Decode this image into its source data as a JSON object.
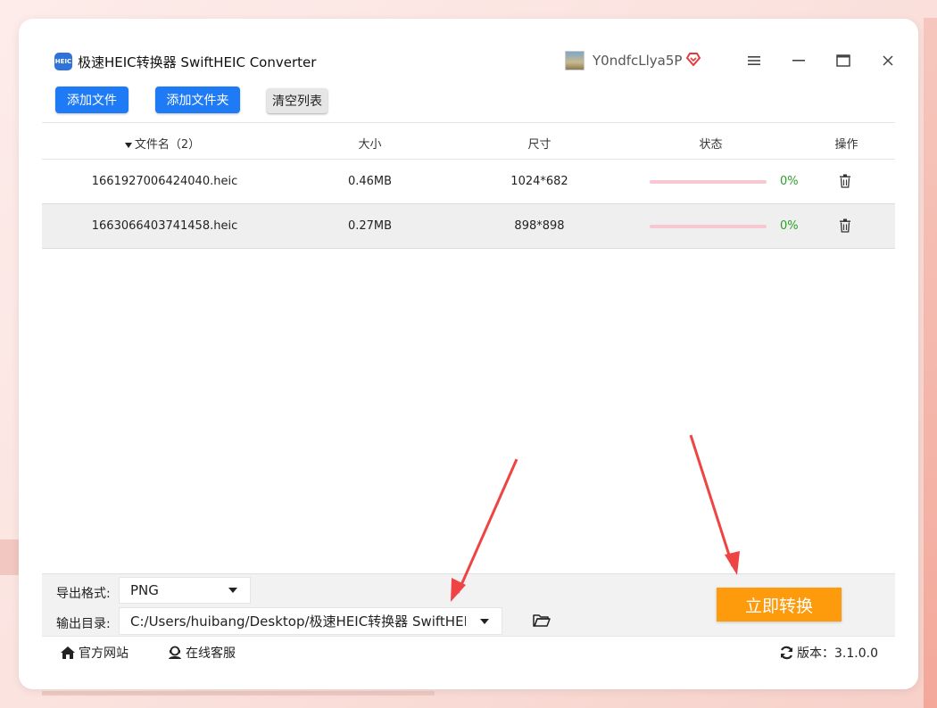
{
  "app": {
    "title": "极速HEIC转换器 SwiftHEIC Converter",
    "logo_text": "HEIC",
    "user_name": "Y0ndfcLlya5P"
  },
  "toolbar": {
    "add_file": "添加文件",
    "add_folder": "添加文件夹",
    "clear_list": "清空列表"
  },
  "table": {
    "headers": {
      "filename": "文件名（2）",
      "size": "大小",
      "dimensions": "尺寸",
      "status": "状态",
      "action": "操作"
    },
    "rows": [
      {
        "filename": "1661927006424040.heic",
        "size": "0.46MB",
        "dimensions": "1024*682",
        "progress": "0%"
      },
      {
        "filename": "1663066403741458.heic",
        "size": "0.27MB",
        "dimensions": "898*898",
        "progress": "0%"
      }
    ]
  },
  "settings": {
    "format_label": "导出格式:",
    "format_value": "PNG",
    "output_label": "输出目录:",
    "output_value": "C:/Users/huibang/Desktop/极速HEIC转换器 SwiftHEIC Converter"
  },
  "convert_button": "立即转换",
  "footer": {
    "website": "官方网站",
    "support": "在线客服",
    "version": "版本：3.1.0.0"
  },
  "colors": {
    "primary": "#1f7af5",
    "convert": "#fd9b0c",
    "progress_track": "#f7c7d2",
    "percent_text": "#2ca02c",
    "annotation_arrow": "#ef4444"
  }
}
